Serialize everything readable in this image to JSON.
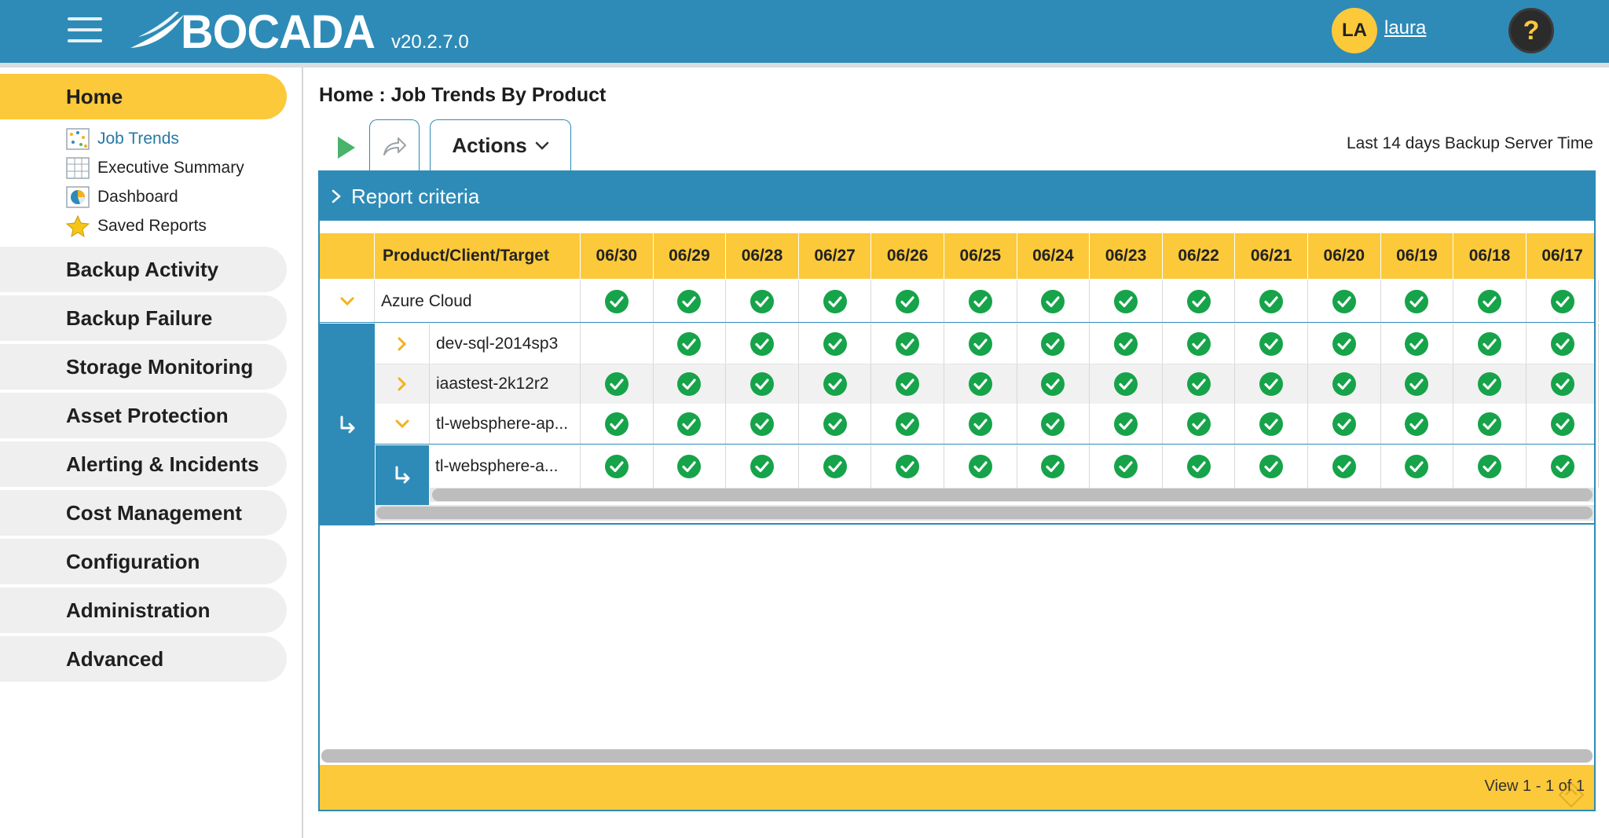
{
  "header": {
    "brand": "BOCADA",
    "version": "v20.2.7.0",
    "avatar_initials": "LA",
    "username": "laura",
    "help_glyph": "?"
  },
  "sidebar": {
    "home_label": "Home",
    "sub_items": [
      {
        "label": "Job Trends",
        "icon": "job-trends-icon"
      },
      {
        "label": "Executive Summary",
        "icon": "table-icon"
      },
      {
        "label": "Dashboard",
        "icon": "dashboard-icon"
      },
      {
        "label": "Saved Reports",
        "icon": "star-icon"
      }
    ],
    "items": [
      "Backup Activity",
      "Backup Failure",
      "Storage Monitoring",
      "Asset Protection",
      "Alerting & Incidents",
      "Cost Management",
      "Configuration",
      "Administration",
      "Advanced"
    ]
  },
  "main": {
    "breadcrumb": "Home : Job Trends By Product",
    "actions_label": "Actions",
    "timeframe": "Last 14 days Backup Server Time",
    "criteria_label": "Report criteria",
    "grid": {
      "name_header": "Product/Client/Target",
      "dates": [
        "06/30",
        "06/29",
        "06/28",
        "06/27",
        "06/26",
        "06/25",
        "06/24",
        "06/23",
        "06/22",
        "06/21",
        "06/20",
        "06/19",
        "06/18",
        "06/17"
      ],
      "rows": [
        {
          "label": "Azure Cloud",
          "status": [
            "ok",
            "ok",
            "ok",
            "ok",
            "ok",
            "ok",
            "ok",
            "ok",
            "ok",
            "ok",
            "ok",
            "ok",
            "ok",
            "ok"
          ]
        },
        {
          "label": "dev-sql-2014sp3",
          "status": [
            "none",
            "ok",
            "ok",
            "ok",
            "ok",
            "ok",
            "ok",
            "ok",
            "ok",
            "ok",
            "ok",
            "ok",
            "ok",
            "ok"
          ]
        },
        {
          "label": "iaastest-2k12r2",
          "status": [
            "ok",
            "ok",
            "ok",
            "ok",
            "ok",
            "ok",
            "ok",
            "ok",
            "ok",
            "ok",
            "ok",
            "ok",
            "ok",
            "ok"
          ]
        },
        {
          "label": "tl-websphere-ap...",
          "status": [
            "ok",
            "ok",
            "ok",
            "ok",
            "ok",
            "ok",
            "ok",
            "ok",
            "ok",
            "ok",
            "ok",
            "ok",
            "ok",
            "ok"
          ]
        },
        {
          "label": "tl-websphere-a...",
          "status": [
            "ok",
            "ok",
            "ok",
            "ok",
            "ok",
            "ok",
            "ok",
            "ok",
            "ok",
            "ok",
            "ok",
            "ok",
            "ok",
            "ok"
          ]
        }
      ]
    },
    "pager": "View 1 - 1 of 1"
  },
  "colors": {
    "brand_blue": "#2e8bb7",
    "accent_yellow": "#fcc93a",
    "success_green": "#16a34a"
  }
}
